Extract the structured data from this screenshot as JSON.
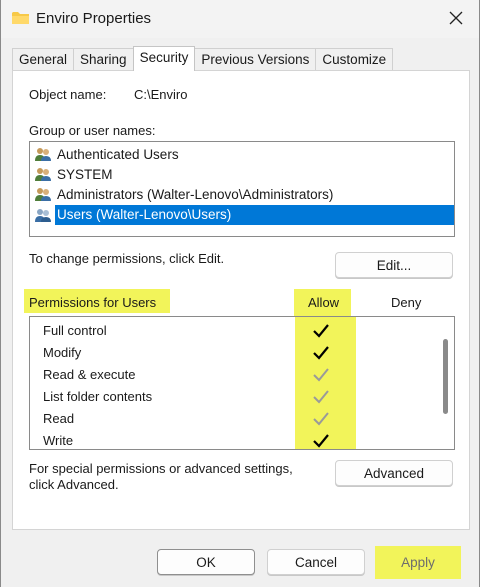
{
  "window": {
    "title": "Enviro Properties"
  },
  "tabs": [
    {
      "label": "General"
    },
    {
      "label": "Sharing"
    },
    {
      "label": "Security",
      "active": true
    },
    {
      "label": "Previous Versions"
    },
    {
      "label": "Customize"
    }
  ],
  "security": {
    "object_name_label": "Object name:",
    "object_name_value": "C:\\Enviro",
    "group_label": "Group or user names:",
    "users": [
      {
        "name": "Authenticated Users"
      },
      {
        "name": "SYSTEM"
      },
      {
        "name": "Administrators (Walter-Lenovo\\Administrators)"
      },
      {
        "name": "Users (Walter-Lenovo\\Users)",
        "selected": true
      }
    ],
    "change_hint": "To change permissions, click Edit.",
    "edit_label": "Edit...",
    "permissions_label": "Permissions for Users",
    "allow_header": "Allow",
    "deny_header": "Deny",
    "permissions": [
      {
        "name": "Full control",
        "allow": "checked"
      },
      {
        "name": "Modify",
        "allow": "checked"
      },
      {
        "name": "Read & execute",
        "allow": "inherited"
      },
      {
        "name": "List folder contents",
        "allow": "inherited"
      },
      {
        "name": "Read",
        "allow": "inherited"
      },
      {
        "name": "Write",
        "allow": "checked"
      }
    ],
    "advanced_hint_line1": "For special permissions or advanced settings,",
    "advanced_hint_line2": "click Advanced.",
    "advanced_label": "Advanced"
  },
  "footer": {
    "ok_label": "OK",
    "cancel_label": "Cancel",
    "apply_label": "Apply"
  },
  "colors": {
    "highlight": "#f2f45a",
    "selection": "#0078d7",
    "check_dark": "#000000",
    "check_inherited": "#9a9a9a"
  }
}
